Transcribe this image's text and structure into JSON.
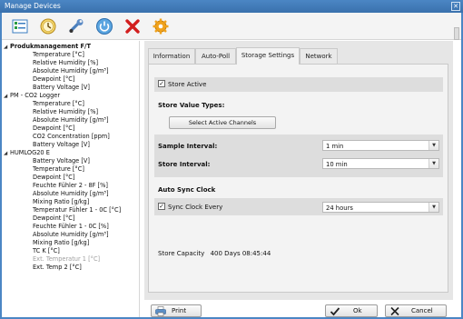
{
  "window": {
    "title": "Manage Devices",
    "close_glyph": "✕"
  },
  "toolbar": {
    "icons": [
      "devices-list-icon",
      "history-clock-icon",
      "wrench-icon",
      "power-icon",
      "delete-x-icon",
      "settings-gear-icon"
    ]
  },
  "tree": {
    "groups": [
      {
        "label": "Produkmanagement F/T",
        "children": [
          "Temperature [°C]",
          "Relative Humidity [%]",
          "Absolute Humidity [g/m³]",
          "Dewpoint [°C]",
          "Battery Voltage [V]"
        ]
      },
      {
        "label": "PM - CO2 Logger",
        "children": [
          "Temperature [°C]",
          "Relative Humidity [%]",
          "Absolute Humidity [g/m³]",
          "Dewpoint [°C]",
          "CO2 Concentration [ppm]",
          "Battery Voltage [V]"
        ]
      },
      {
        "label": "HUMLOG20 E",
        "children": [
          "Battery Voltage [V]",
          "Temperature [°C]",
          "Dewpoint [°C]",
          "Feuchte Fühler 2 - 8F [%]",
          "Absolute Humidity [g/m³]",
          "Mixing Ratio [g/kg]",
          "Temperatur Fühler 1 - 0C [°C]",
          "Dewpoint [°C]",
          "Feuchte Fühler 1 - 0C [%]",
          "Absolute Humidity [g/m³]",
          "Mixing Ratio [g/kg]",
          "TC K [°C]",
          "Ext. Temperatur 1 [°C]",
          "Ext. Temp 2 [°C]"
        ]
      }
    ]
  },
  "tabs": [
    "Information",
    "Auto-Poll",
    "Storage Settings",
    "Network"
  ],
  "active_tab": "Storage Settings",
  "storage": {
    "store_active_label": "Store Active",
    "store_active_checked": true,
    "value_types_heading": "Store Value Types:",
    "select_channels_button": "Select Active Channels",
    "sample_interval_label": "Sample Interval:",
    "sample_interval_value": "1 min",
    "store_interval_label": "Store Interval:",
    "store_interval_value": "10 min",
    "auto_sync_heading": "Auto Sync Clock",
    "sync_every_label": "Sync Clock Every",
    "sync_every_checked": true,
    "sync_every_value": "24 hours",
    "capacity_label": "Store Capacity",
    "capacity_value": "400 Days 08:45:44"
  },
  "footer": {
    "print": "Print",
    "ok": "Ok",
    "cancel": "Cancel"
  },
  "colors": {
    "titlebar": "#3a71ad",
    "panel": "#e6e6e6",
    "accent_orange": "#f0a21c"
  }
}
